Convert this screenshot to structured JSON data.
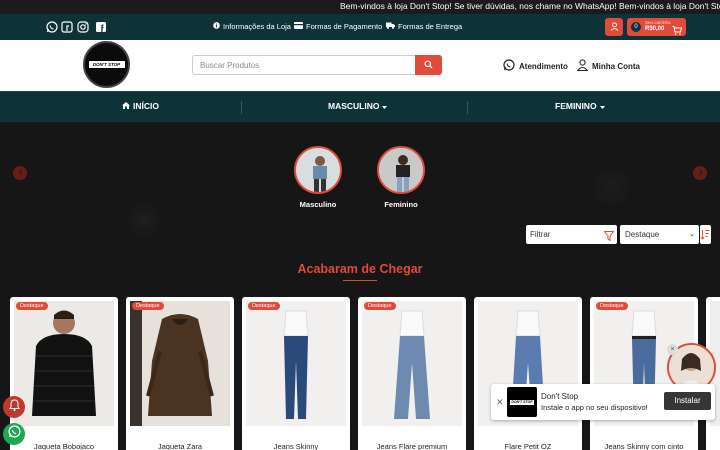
{
  "marquee": {
    "text": "Bem-vindos à loja Don't Stop! Se tiver dúvidas, nos chame no WhatsApp!   Bem-vindos à loja Don't Stop! Se"
  },
  "topbar": {
    "links": [
      {
        "icon": "info-icon",
        "label": "Informações da Loja"
      },
      {
        "icon": "card-icon",
        "label": "Formas de Pagamento"
      },
      {
        "icon": "truck-icon",
        "label": "Formas de Entrega"
      }
    ],
    "cart": {
      "count": "0",
      "label": "Seu carrinho",
      "total": "R$0,00"
    }
  },
  "header": {
    "logo_text": "DON'T STOP",
    "search_placeholder": "Buscar Produtos",
    "atendimento": "Atendimento",
    "conta": "Minha Conta"
  },
  "nav": {
    "items": [
      {
        "label": "INÍCIO"
      },
      {
        "label": "MASCULINO"
      },
      {
        "label": "FEMININO"
      }
    ]
  },
  "categories": [
    {
      "label": "Masculino"
    },
    {
      "label": "Feminino"
    }
  ],
  "filters": {
    "filter_label": "Filtrar",
    "sort_label": "Destaque"
  },
  "section": {
    "title": "Acabaram de Chegar"
  },
  "products": [
    {
      "badge": "Destaque",
      "name": "Jaqueta Bobojaco"
    },
    {
      "badge": "Destaque",
      "name": "Jaqueta Zara"
    },
    {
      "badge": "Destaque",
      "name": "Jeans Skinny"
    },
    {
      "badge": "Destaque",
      "name": "Jeans Flare premium"
    },
    {
      "badge": "",
      "name": "Flare Petit OZ"
    },
    {
      "badge": "Destaque",
      "name": "Jeans Skinny com cinto"
    }
  ],
  "promo": {
    "title": "Don't Stop",
    "text": "Instale o app no seu dispositivo!",
    "button": "Instalar"
  },
  "colors": {
    "accent": "#e04b3a",
    "dark_teal": "#0d3339",
    "background": "#131313"
  }
}
